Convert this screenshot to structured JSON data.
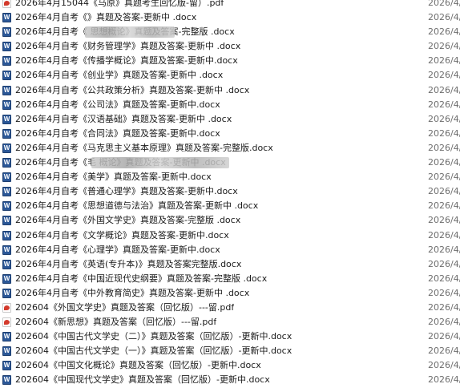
{
  "files": [
    {
      "icon": "pdf-icon",
      "name": "2026年4月15044《马原》真题考生回忆版-留）.pdf",
      "date": "2026/4/"
    },
    {
      "icon": "word-icon",
      "name": "2026年4月自考《》真题及答案-更新中 .docx",
      "date": "2026/4/"
    },
    {
      "icon": "word-icon",
      "name": "2026年4月自考《 思想概论》真题及答案-完整版 .docx",
      "date": "2026/4/"
    },
    {
      "icon": "word-icon",
      "name": "2026年4月自考《财务管理学》真题及答案-更新中 .docx",
      "date": "2026/4/"
    },
    {
      "icon": "word-icon",
      "name": "2026年4月自考《传播学概论》真题及答案-更新中.docx",
      "date": "2026/4/"
    },
    {
      "icon": "word-icon",
      "name": "2026年4月自考《创业学》真题及答案-更新中 .docx",
      "date": "2026/4/"
    },
    {
      "icon": "word-icon",
      "name": "2026年4月自考《公共政策分析》真题及答案-更新中 .docx",
      "date": "2026/4/"
    },
    {
      "icon": "word-icon",
      "name": "2026年4月自考《公司法》真题及答案-更新中.docx",
      "date": "2026/4/"
    },
    {
      "icon": "word-icon",
      "name": "2026年4月自考《汉语基础》真题及答案-更新中 .docx",
      "date": "2026/4/"
    },
    {
      "icon": "word-icon",
      "name": "2026年4月自考《合同法》真题及答案-更新中.docx",
      "date": "2026/4/"
    },
    {
      "icon": "word-icon",
      "name": "2026年4月自考《马克思主义基本原理》真题及答案-完整版.docx",
      "date": "2026/4/"
    },
    {
      "icon": "word-icon",
      "name": "2026年4月自考《毛 概论》真题及答案-更新中 .docx",
      "date": "2026/4/"
    },
    {
      "icon": "word-icon",
      "name": "2026年4月自考《美学》真题及答案-更新中.docx",
      "date": "2026/4/"
    },
    {
      "icon": "word-icon",
      "name": "2026年4月自考《普通心理学》真题及答案-更新中.docx",
      "date": "2026/4/"
    },
    {
      "icon": "word-icon",
      "name": "2026年4月自考《思想道德与法治》真题及答案-更新中 .docx",
      "date": "2026/4/"
    },
    {
      "icon": "word-icon",
      "name": "2026年4月自考《外国文学史》真题及答案-完整版 .docx",
      "date": "2026/4/"
    },
    {
      "icon": "word-icon",
      "name": "2026年4月自考《文学概论》真题及答案-更新中.docx",
      "date": "2026/4/"
    },
    {
      "icon": "word-icon",
      "name": "2026年4月自考《心理学》真题及答案-更新中.docx",
      "date": "2026/4/"
    },
    {
      "icon": "word-icon",
      "name": "2026年4月自考《英语(专升本)》真题及答案完整版.docx",
      "date": "2026/4/"
    },
    {
      "icon": "word-icon",
      "name": "2026年4月自考《中国近现代史纲要》真题及答案-完整版 .docx",
      "date": "2026/4/"
    },
    {
      "icon": "word-icon",
      "name": "2026年4月自考《中外教育简史》真题及答案-更新中 .docx",
      "date": "2026/4/"
    },
    {
      "icon": "pdf-icon",
      "name": "202604《外国文学史》真题及答案（回忆版）---留.pdf",
      "date": "2026/4/"
    },
    {
      "icon": "pdf-icon",
      "name": "202604《新思想》真题及答案（回忆版）---留.pdf",
      "date": "2026/4/"
    },
    {
      "icon": "word-icon",
      "name": "202604《中国古代文学史（二）》真题及答案（回忆版）-更新中.docx",
      "date": "2026/4/"
    },
    {
      "icon": "word-icon",
      "name": "202604《中国古代文学史（一）》真题及答案（回忆版）-更新中.docx",
      "date": "2026/4/"
    },
    {
      "icon": "word-icon",
      "name": "202604《中国文化概论》真题及答案（回忆版）-更新中.docx",
      "date": "2026/4/"
    },
    {
      "icon": "word-icon",
      "name": "202604《中国现代文学史》真题及答案（回忆版）-更新中.docx",
      "date": "2026/4/"
    }
  ]
}
